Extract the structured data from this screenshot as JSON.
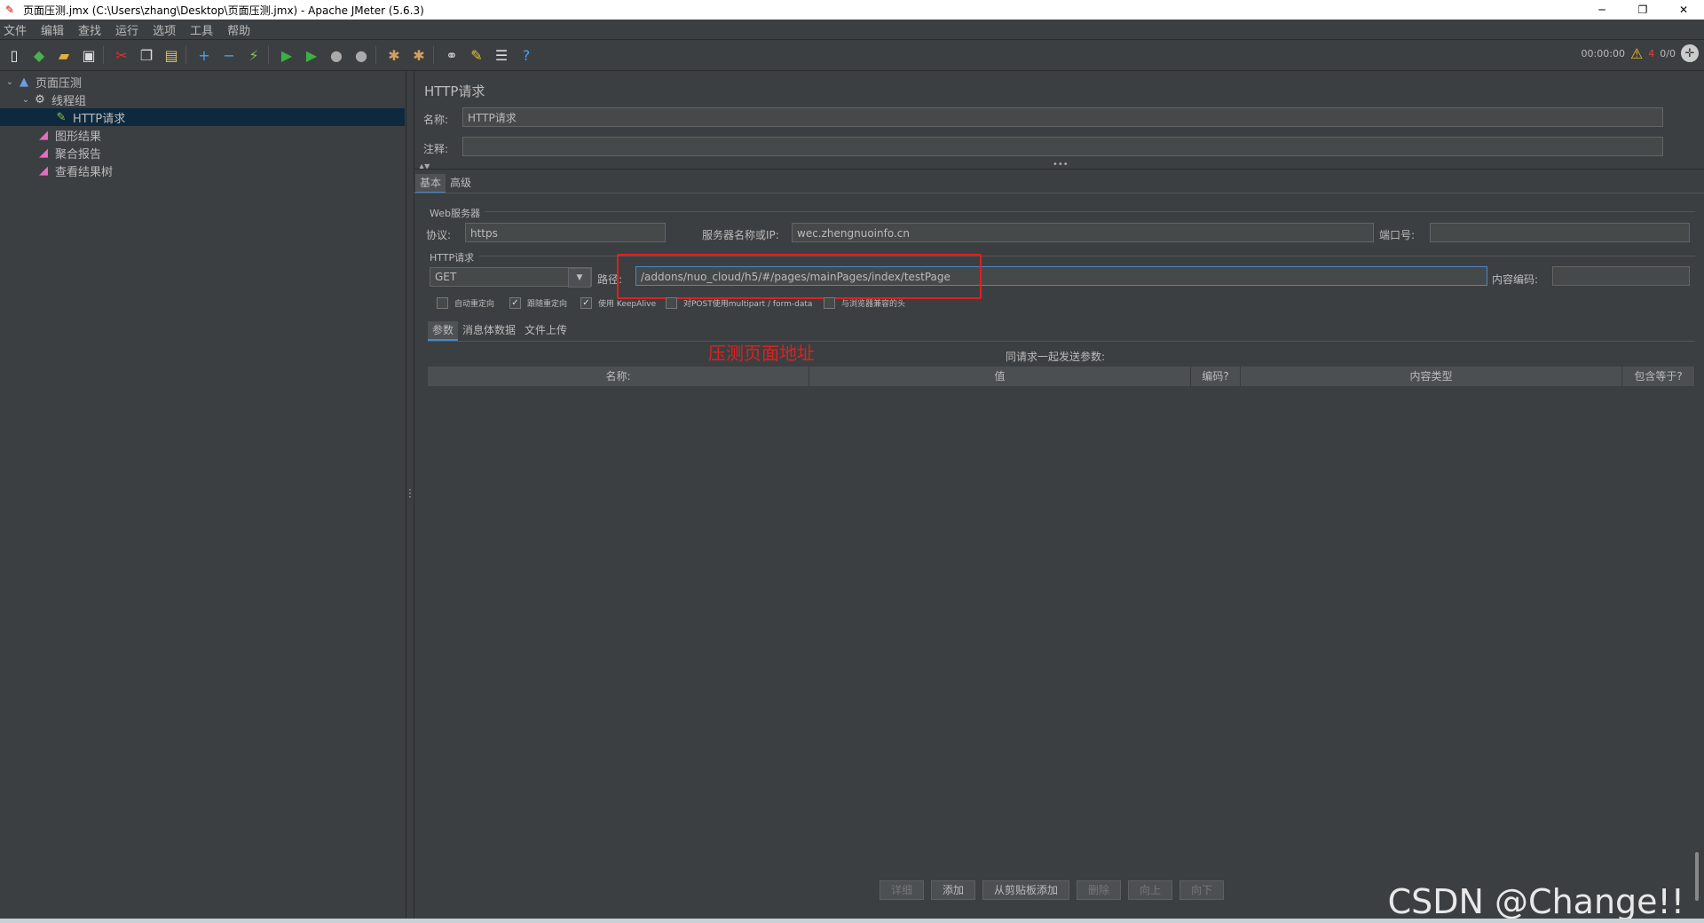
{
  "window": {
    "title": "页面压测.jmx (C:\\Users\\zhang\\Desktop\\页面压测.jmx) - Apache JMeter (5.6.3)"
  },
  "menu": [
    "文件",
    "编辑",
    "查找",
    "运行",
    "选项",
    "工具",
    "帮助"
  ],
  "status": {
    "time": "00:00:00",
    "warnings": "4",
    "threads": "0/0"
  },
  "tree": {
    "items": [
      {
        "label": "页面压测",
        "icon": "test-plan-icon"
      },
      {
        "label": "线程组",
        "icon": "gear-icon"
      },
      {
        "label": "HTTP请求",
        "icon": "pipette-icon"
      },
      {
        "label": "图形结果",
        "icon": "chart-icon"
      },
      {
        "label": "聚合报告",
        "icon": "chart-icon"
      },
      {
        "label": "查看结果树",
        "icon": "chart-icon"
      }
    ]
  },
  "panel": {
    "title": "HTTP请求",
    "name_label": "名称:",
    "name_value": "HTTP请求",
    "comment_label": "注释:",
    "comment_value": "",
    "tabs": [
      "基本",
      "高级"
    ],
    "web_server_label": "Web服务器",
    "protocol_label": "协议:",
    "protocol_value": "https",
    "server_label": "服务器名称或IP:",
    "server_value": "wec.zhengnuoinfo.cn",
    "port_label": "端口号:",
    "port_value": "",
    "http_request_label": "HTTP请求",
    "method_value": "GET",
    "path_label": "路径:",
    "path_value": "/addons/nuo_cloud/h5/#/pages/mainPages/index/testPage",
    "encoding_label": "内容编码:",
    "encoding_value": "",
    "checkboxes": [
      {
        "label": "自动重定向",
        "checked": false
      },
      {
        "label": "跟随重定向",
        "checked": true
      },
      {
        "label": "使用 KeepAlive",
        "checked": true
      },
      {
        "label": "对POST使用multipart / form-data",
        "checked": false
      },
      {
        "label": "与浏览器兼容的头",
        "checked": false
      }
    ],
    "sub_tabs": [
      "参数",
      "消息体数据",
      "文件上传"
    ],
    "params_caption": "同请求一起发送参数:",
    "table_headers": [
      "名称:",
      "值",
      "编码?",
      "内容类型",
      "包含等于?"
    ],
    "buttons": [
      {
        "label": "详细",
        "disabled": true
      },
      {
        "label": "添加",
        "disabled": false
      },
      {
        "label": "从剪贴板添加",
        "disabled": false
      },
      {
        "label": "删除",
        "disabled": true
      },
      {
        "label": "向上",
        "disabled": true
      },
      {
        "label": "向下",
        "disabled": true
      }
    ]
  },
  "annotation": "压测页面地址",
  "watermark": "CSDN @Change!!"
}
